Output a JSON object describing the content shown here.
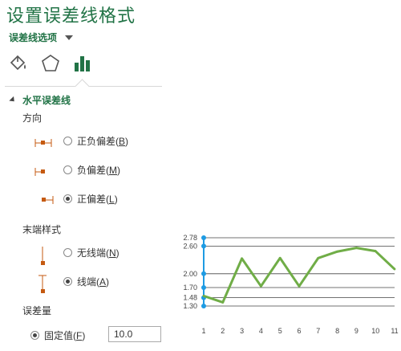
{
  "panel": {
    "title": "设置误差线格式",
    "options_menu": "误差线选项",
    "tabs": [
      {
        "icon": "fill-bucket-icon"
      },
      {
        "icon": "pentagon-icon"
      },
      {
        "icon": "bar-chart-icon"
      }
    ],
    "section": "水平误差线",
    "direction_label": "方向",
    "direction_options": [
      {
        "label": "正负偏差(",
        "key": "B",
        "close": ")",
        "selected": false
      },
      {
        "label": "负偏差(",
        "key": "M",
        "close": ")",
        "selected": false
      },
      {
        "label": "正偏差(",
        "key": "L",
        "close": ")",
        "selected": true
      }
    ],
    "end_style_label": "末端样式",
    "end_style_options": [
      {
        "label": "无线端(",
        "key": "N",
        "close": ")",
        "selected": false
      },
      {
        "label": "线端(",
        "key": "A",
        "close": ")",
        "selected": true
      }
    ],
    "amount_label": "误差量",
    "fixed_value_label": "固定值(",
    "fixed_value_key": "F",
    "fixed_value_close": ")",
    "fixed_value": "10.0",
    "accent": "#217346"
  },
  "chart_data": {
    "type": "line",
    "x": [
      1,
      2,
      3,
      4,
      5,
      6,
      7,
      8,
      9,
      10,
      11
    ],
    "values": [
      1.52,
      1.38,
      2.33,
      1.73,
      2.34,
      1.73,
      2.34,
      2.48,
      2.56,
      2.49,
      2.1
    ],
    "y_ticks": [
      "1.30",
      "1.48",
      "1.70",
      "2.00",
      "2.60",
      "2.78"
    ],
    "y_tick_values": [
      1.3,
      1.48,
      1.7,
      2.0,
      2.6,
      2.78
    ],
    "x_ticks": [
      "1",
      "2",
      "3",
      "4",
      "5",
      "6",
      "7",
      "8",
      "9",
      "10",
      "11"
    ],
    "ylim": [
      1.3,
      2.78
    ],
    "grid": true,
    "line_color": "#70ad47",
    "error_bar_color": "#1e9be3"
  }
}
